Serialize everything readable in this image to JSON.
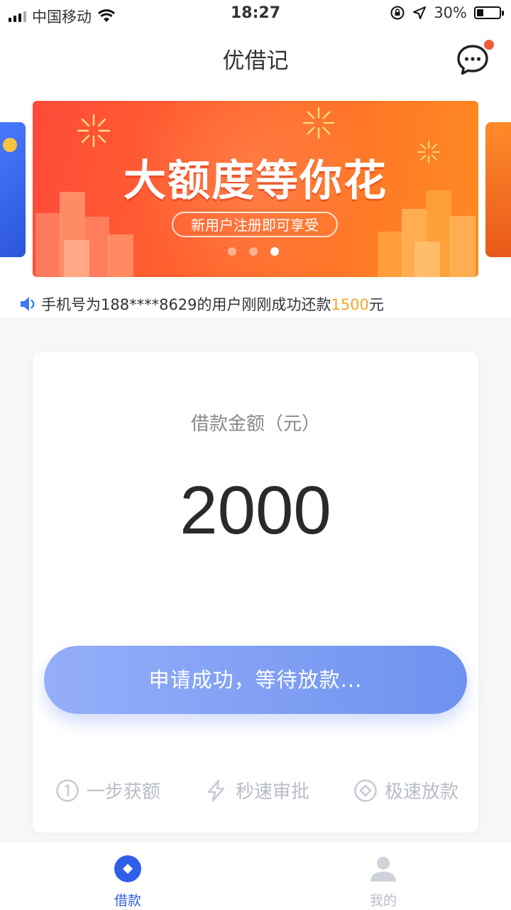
{
  "status_bar": {
    "carrier": "中国移动",
    "time": "18:27",
    "battery_percent": "30%",
    "battery_level": 0.3
  },
  "navbar": {
    "title": "优借记",
    "message_icon": "chat-bubble-icon"
  },
  "banner": {
    "headline": "大额度等你花",
    "subtitle": "新用户注册即可享受",
    "slide_count": 3,
    "active_slide": 3
  },
  "notice": {
    "prefix": "手机号为188****8629的用户刚刚成功还款",
    "amount": "1500",
    "suffix": "元"
  },
  "loan_card": {
    "label": "借款金额（元）",
    "amount": "2000",
    "button_label": "申请成功，等待放款...",
    "features": [
      {
        "label": "一步获额",
        "icon": "one-circle-icon"
      },
      {
        "label": "秒速审批",
        "icon": "lightning-icon"
      },
      {
        "label": "极速放款",
        "icon": "diamond-circle-icon"
      }
    ]
  },
  "tabbar": {
    "items": [
      {
        "label": "借款",
        "icon": "loan-icon",
        "active": true
      },
      {
        "label": "我的",
        "icon": "user-icon",
        "active": false
      }
    ]
  },
  "colors": {
    "accent_blue": "#2f5fe8",
    "highlight_orange": "#f5a623",
    "badge_red": "#f05a3a",
    "inactive_gray": "#b8bcc6"
  }
}
